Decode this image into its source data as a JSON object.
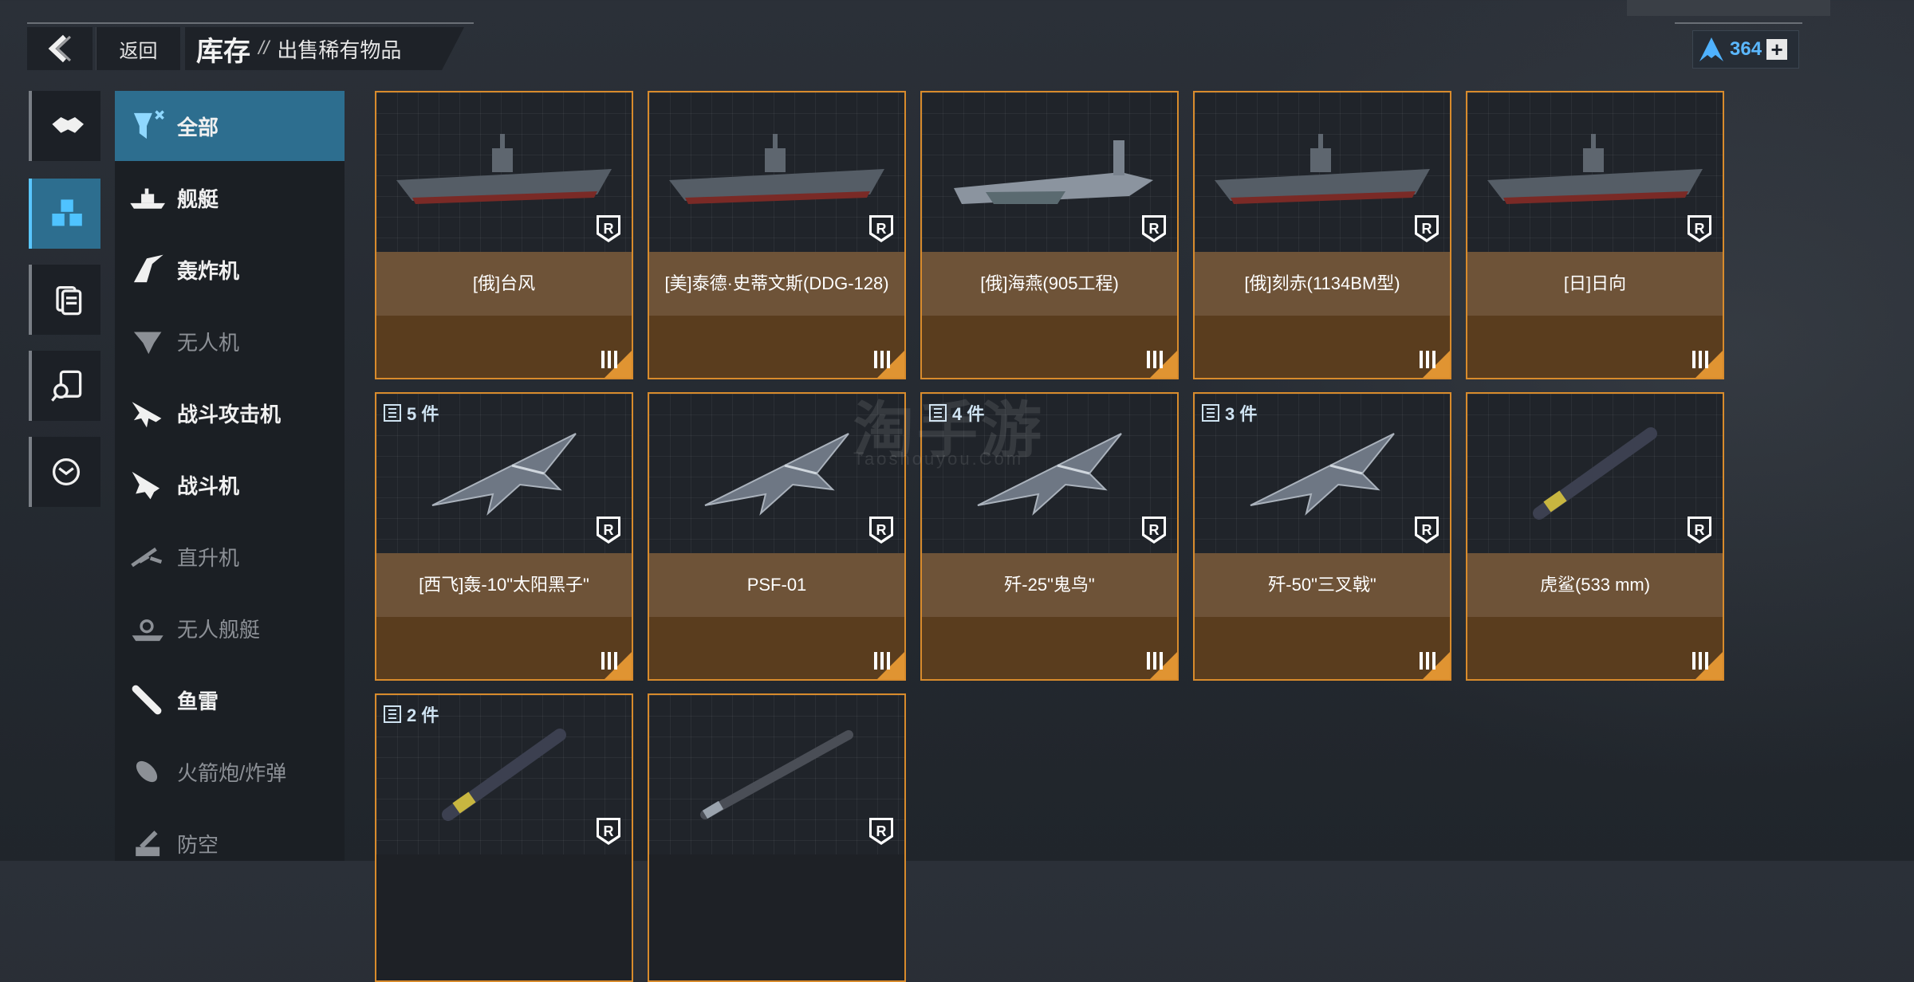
{
  "header": {
    "back_label": "返回",
    "title": "库存",
    "separator": "//",
    "subtitle": "出售稀有物品"
  },
  "currency": {
    "value": "364",
    "icon": "a-logo-icon",
    "plus": "+"
  },
  "rail": [
    {
      "name": "handshake-icon",
      "active": false
    },
    {
      "name": "cubes-icon",
      "active": true
    },
    {
      "name": "documents-icon",
      "active": false
    },
    {
      "name": "document-search-icon",
      "active": false
    },
    {
      "name": "recycle-icon",
      "active": false
    }
  ],
  "categories": [
    {
      "label": "全部",
      "icon": "all-filter-icon",
      "active": true,
      "dim": false
    },
    {
      "label": "舰艇",
      "icon": "warship-icon",
      "active": false,
      "dim": false
    },
    {
      "label": "轰炸机",
      "icon": "bomber-icon",
      "active": false,
      "dim": false
    },
    {
      "label": "无人机",
      "icon": "drone-icon",
      "active": false,
      "dim": true
    },
    {
      "label": "战斗攻击机",
      "icon": "strike-fighter-icon",
      "active": false,
      "dim": false
    },
    {
      "label": "战斗机",
      "icon": "fighter-icon",
      "active": false,
      "dim": false
    },
    {
      "label": "直升机",
      "icon": "helicopter-icon",
      "active": false,
      "dim": true
    },
    {
      "label": "无人舰艇",
      "icon": "unmanned-ship-icon",
      "active": false,
      "dim": true
    },
    {
      "label": "鱼雷",
      "icon": "torpedo-icon",
      "active": false,
      "dim": false
    },
    {
      "label": "火箭炮/炸弹",
      "icon": "rocket-bomb-icon",
      "active": false,
      "dim": true
    },
    {
      "label": "防空",
      "icon": "air-defense-icon",
      "active": false,
      "dim": true
    }
  ],
  "items": [
    {
      "name": "[俄]台风",
      "type": "ship",
      "count": "",
      "rarity": "R"
    },
    {
      "name": "[美]泰德·史蒂文斯(DDG-128)",
      "type": "ship",
      "count": "",
      "rarity": "R"
    },
    {
      "name": "[俄]海燕(905工程)",
      "type": "ekranoplan",
      "count": "",
      "rarity": "R"
    },
    {
      "name": "[俄]刻赤(1134BM型)",
      "type": "ship",
      "count": "",
      "rarity": "R"
    },
    {
      "name": "[日]日向",
      "type": "carrier",
      "count": "",
      "rarity": "R"
    },
    {
      "name": "[西飞]轰-10\"太阳黑子\"",
      "type": "jet",
      "count": "5 件",
      "rarity": "R"
    },
    {
      "name": "PSF-01",
      "type": "jet",
      "count": "",
      "rarity": "R"
    },
    {
      "name": "歼-25\"鬼鸟\"",
      "type": "jet",
      "count": "4 件",
      "rarity": "R"
    },
    {
      "name": "歼-50\"三叉戟\"",
      "type": "jet",
      "count": "3 件",
      "rarity": "R"
    },
    {
      "name": "虎鲨(533 mm)",
      "type": "torpedo",
      "count": "",
      "rarity": "R"
    },
    {
      "name": "",
      "type": "torpedo",
      "count": "2 件",
      "rarity": "R"
    },
    {
      "name": "",
      "type": "missile",
      "count": "",
      "rarity": "R"
    }
  ],
  "watermark": {
    "main": "淘手游",
    "sub": "Taoshouyou.Com"
  },
  "colors": {
    "accent": "#2d6e8f",
    "card_border": "#d88b2c",
    "name_band": "#6e5338",
    "foot_band": "#5a3d1e",
    "currency": "#5bb8ff"
  }
}
